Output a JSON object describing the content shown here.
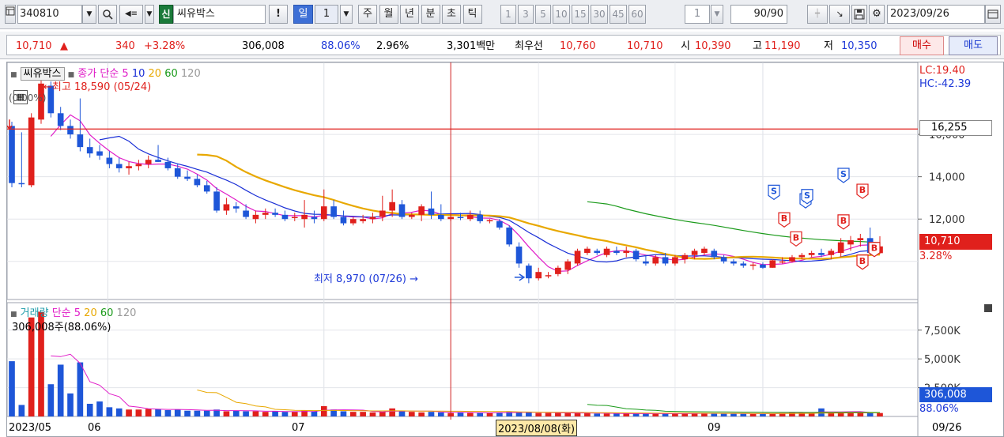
{
  "toolbar": {
    "stock_code": "340810",
    "badge": "신",
    "stock_name": "씨유박스",
    "period_day": "일",
    "period_num": "1",
    "periods": [
      "주",
      "월",
      "년",
      "분",
      "초",
      "틱"
    ],
    "minute_options": [
      "1",
      "3",
      "5",
      "10",
      "15",
      "30",
      "45",
      "60"
    ],
    "tick_value": "1",
    "count_current": "90",
    "count_total": "/90",
    "date": "2023/09/26"
  },
  "quote": {
    "price": "10,710",
    "up_mark": "▲",
    "change": "340",
    "change_pct": "+3.28%",
    "volume": "306,008",
    "volume_ratio": "88.06%",
    "turnover": "2.96%",
    "amount": "3,301백만",
    "best_label": "최우선",
    "best_ask": "10,760",
    "best_bid": "10,710",
    "open_label": "시",
    "open": "10,390",
    "high_label": "고",
    "high": "11,190",
    "low_label": "저",
    "low": "10,350",
    "buy_label": "매수",
    "sell_label": "매도"
  },
  "price_panel": {
    "name": "씨유박스",
    "ma_label": "종가 단순",
    "ma_periods": [
      "5",
      "10",
      "20",
      "60",
      "120"
    ],
    "high_marker": "←최고 18,590 (05/24)",
    "low_marker": "최저 8,970 (07/26) →",
    "left_pct": "(0.00%)",
    "lc": "LC:19.40",
    "hc": "HC:-42.39",
    "ref_price": "16,255",
    "axis_top_partial": "16,000",
    "current_price": "10,710",
    "current_pct": "3.28%"
  },
  "volume_panel": {
    "label": "거래량",
    "ma_label": "단순",
    "ma_periods": [
      "5",
      "20",
      "60",
      "120"
    ],
    "current_text": "306,008주(88.06%)",
    "current_volume": "306,008",
    "current_ratio": "88.06%",
    "axis_labels": [
      "7,500K",
      "5,000K",
      "2,500K"
    ]
  },
  "x_axis": {
    "start": "2023/05",
    "months": [
      "06",
      "07",
      "09"
    ],
    "cursor_date": "2023/08/08(화)",
    "end": "09/26"
  },
  "colors": {
    "up": "#e0201c",
    "down": "#1e56d8",
    "ma5": "#e01cc8",
    "ma10": "#1a2fd6",
    "ma20": "#e8a800",
    "ma60": "#1a9a1a",
    "ref_line": "#e0201c"
  },
  "signals": [
    "S",
    "B"
  ],
  "chart_data": {
    "type": "candlestick",
    "price_axis": {
      "ticks": [
        12000,
        14000,
        16000
      ],
      "min": 8200,
      "max": 19400
    },
    "volume_axis": {
      "ticks": [
        2500,
        5000,
        7500
      ],
      "unit": "K",
      "min": 0,
      "max": 9200
    },
    "candles": [
      {
        "o": 16400,
        "h": 16600,
        "l": 13500,
        "c": 13700
      },
      {
        "o": 13700,
        "h": 16100,
        "l": 13500,
        "c": 13650
      },
      {
        "o": 13600,
        "h": 17000,
        "l": 13500,
        "c": 16800
      },
      {
        "o": 16700,
        "h": 18590,
        "l": 16500,
        "c": 18400
      },
      {
        "o": 18300,
        "h": 18500,
        "l": 16800,
        "c": 17000
      },
      {
        "o": 17000,
        "h": 17300,
        "l": 16200,
        "c": 16400
      },
      {
        "o": 16400,
        "h": 16700,
        "l": 15800,
        "c": 16000
      },
      {
        "o": 16000,
        "h": 17700,
        "l": 15200,
        "c": 15400
      },
      {
        "o": 15400,
        "h": 15800,
        "l": 14900,
        "c": 15100
      },
      {
        "o": 15200,
        "h": 15500,
        "l": 14800,
        "c": 15000
      },
      {
        "o": 14900,
        "h": 15200,
        "l": 14400,
        "c": 14600
      },
      {
        "o": 14600,
        "h": 14900,
        "l": 14200,
        "c": 14400
      },
      {
        "o": 14400,
        "h": 14700,
        "l": 14100,
        "c": 14500
      },
      {
        "o": 14500,
        "h": 14800,
        "l": 14300,
        "c": 14600
      },
      {
        "o": 14600,
        "h": 15000,
        "l": 14400,
        "c": 14800
      },
      {
        "o": 14800,
        "h": 15500,
        "l": 14700,
        "c": 14700
      },
      {
        "o": 14700,
        "h": 14900,
        "l": 14300,
        "c": 14400
      },
      {
        "o": 14400,
        "h": 14600,
        "l": 13900,
        "c": 14000
      },
      {
        "o": 14000,
        "h": 14300,
        "l": 13800,
        "c": 13900
      },
      {
        "o": 13900,
        "h": 14100,
        "l": 13500,
        "c": 13600
      },
      {
        "o": 13600,
        "h": 13800,
        "l": 13200,
        "c": 13300
      },
      {
        "o": 13300,
        "h": 13500,
        "l": 12300,
        "c": 12400
      },
      {
        "o": 12400,
        "h": 13000,
        "l": 12200,
        "c": 12700
      },
      {
        "o": 12600,
        "h": 12800,
        "l": 12300,
        "c": 12500
      },
      {
        "o": 12400,
        "h": 12700,
        "l": 12000,
        "c": 12100
      },
      {
        "o": 12000,
        "h": 12400,
        "l": 11800,
        "c": 12200
      },
      {
        "o": 12200,
        "h": 12500,
        "l": 12000,
        "c": 12300
      },
      {
        "o": 12300,
        "h": 12500,
        "l": 12100,
        "c": 12200
      },
      {
        "o": 12200,
        "h": 12400,
        "l": 11900,
        "c": 12000
      },
      {
        "o": 12100,
        "h": 12300,
        "l": 11900,
        "c": 12100
      },
      {
        "o": 12000,
        "h": 12900,
        "l": 11600,
        "c": 12200
      },
      {
        "o": 12100,
        "h": 12400,
        "l": 11800,
        "c": 12000
      },
      {
        "o": 12000,
        "h": 13400,
        "l": 11900,
        "c": 12600
      },
      {
        "o": 12600,
        "h": 12900,
        "l": 12000,
        "c": 12100
      },
      {
        "o": 12100,
        "h": 12400,
        "l": 11700,
        "c": 11800
      },
      {
        "o": 11800,
        "h": 12100,
        "l": 11700,
        "c": 12000
      },
      {
        "o": 11900,
        "h": 12200,
        "l": 11800,
        "c": 12000
      },
      {
        "o": 12000,
        "h": 12300,
        "l": 11800,
        "c": 12100
      },
      {
        "o": 12100,
        "h": 13100,
        "l": 11900,
        "c": 12400
      },
      {
        "o": 12400,
        "h": 13400,
        "l": 12100,
        "c": 12800
      },
      {
        "o": 12700,
        "h": 12900,
        "l": 12000,
        "c": 12100
      },
      {
        "o": 12100,
        "h": 12300,
        "l": 12000,
        "c": 12200
      },
      {
        "o": 12200,
        "h": 12700,
        "l": 11900,
        "c": 12600
      },
      {
        "o": 12500,
        "h": 13300,
        "l": 12000,
        "c": 12200
      },
      {
        "o": 12200,
        "h": 12700,
        "l": 11900,
        "c": 12000
      },
      {
        "o": 12000,
        "h": 12300,
        "l": 11900,
        "c": 12100
      },
      {
        "o": 12100,
        "h": 12300,
        "l": 11950,
        "c": 12050
      },
      {
        "o": 12000,
        "h": 12400,
        "l": 11900,
        "c": 12200
      },
      {
        "o": 12200,
        "h": 12400,
        "l": 11800,
        "c": 11900
      },
      {
        "o": 11900,
        "h": 12000,
        "l": 11800,
        "c": 11950
      },
      {
        "o": 11900,
        "h": 12000,
        "l": 11500,
        "c": 11600
      },
      {
        "o": 11600,
        "h": 11700,
        "l": 10700,
        "c": 10800
      },
      {
        "o": 10700,
        "h": 10900,
        "l": 9700,
        "c": 9900
      },
      {
        "o": 9800,
        "h": 9900,
        "l": 8970,
        "c": 9200
      },
      {
        "o": 9200,
        "h": 9700,
        "l": 9100,
        "c": 9500
      },
      {
        "o": 9300,
        "h": 9500,
        "l": 9200,
        "c": 9350
      },
      {
        "o": 9400,
        "h": 9800,
        "l": 9300,
        "c": 9700
      },
      {
        "o": 9600,
        "h": 10100,
        "l": 9400,
        "c": 10000
      },
      {
        "o": 9900,
        "h": 10600,
        "l": 9800,
        "c": 10500
      },
      {
        "o": 10400,
        "h": 10700,
        "l": 10300,
        "c": 10600
      },
      {
        "o": 10500,
        "h": 10600,
        "l": 10300,
        "c": 10400
      },
      {
        "o": 10300,
        "h": 10700,
        "l": 10200,
        "c": 10600
      },
      {
        "o": 10500,
        "h": 10700,
        "l": 10300,
        "c": 10400
      },
      {
        "o": 10400,
        "h": 10700,
        "l": 10200,
        "c": 10500
      },
      {
        "o": 10500,
        "h": 10600,
        "l": 10000,
        "c": 10100
      },
      {
        "o": 10000,
        "h": 10300,
        "l": 9800,
        "c": 9900
      },
      {
        "o": 9900,
        "h": 10300,
        "l": 9800,
        "c": 10200
      },
      {
        "o": 10200,
        "h": 10400,
        "l": 9800,
        "c": 9900
      },
      {
        "o": 9900,
        "h": 10300,
        "l": 9800,
        "c": 10200
      },
      {
        "o": 10100,
        "h": 10400,
        "l": 9900,
        "c": 10300
      },
      {
        "o": 10300,
        "h": 10600,
        "l": 10100,
        "c": 10500
      },
      {
        "o": 10400,
        "h": 10700,
        "l": 10300,
        "c": 10600
      },
      {
        "o": 10500,
        "h": 10600,
        "l": 10100,
        "c": 10200
      },
      {
        "o": 10200,
        "h": 10300,
        "l": 9900,
        "c": 10000
      },
      {
        "o": 10000,
        "h": 10100,
        "l": 9800,
        "c": 9900
      },
      {
        "o": 9900,
        "h": 10000,
        "l": 9700,
        "c": 9800
      },
      {
        "o": 9800,
        "h": 9950,
        "l": 9600,
        "c": 9850
      },
      {
        "o": 9850,
        "h": 9950,
        "l": 9650,
        "c": 9700
      },
      {
        "o": 9700,
        "h": 10100,
        "l": 9700,
        "c": 10050
      },
      {
        "o": 10000,
        "h": 10200,
        "l": 9900,
        "c": 10000
      },
      {
        "o": 10000,
        "h": 10300,
        "l": 9950,
        "c": 10200
      },
      {
        "o": 10200,
        "h": 10400,
        "l": 10100,
        "c": 10300
      },
      {
        "o": 10300,
        "h": 10500,
        "l": 10200,
        "c": 10400
      },
      {
        "o": 10400,
        "h": 10600,
        "l": 10200,
        "c": 10300
      },
      {
        "o": 10300,
        "h": 10600,
        "l": 10100,
        "c": 10500
      },
      {
        "o": 10400,
        "h": 11100,
        "l": 10200,
        "c": 10900
      },
      {
        "o": 10800,
        "h": 11200,
        "l": 10500,
        "c": 11000
      },
      {
        "o": 11000,
        "h": 11300,
        "l": 10700,
        "c": 11100
      },
      {
        "o": 11100,
        "h": 11600,
        "l": 10300,
        "c": 10400
      },
      {
        "o": 10390,
        "h": 11190,
        "l": 10350,
        "c": 10710
      }
    ],
    "volumes_K": [
      4800,
      1000,
      8600,
      9100,
      2800,
      4500,
      2000,
      4700,
      1100,
      1300,
      800,
      700,
      600,
      600,
      650,
      650,
      550,
      600,
      500,
      500,
      500,
      600,
      450,
      500,
      450,
      450,
      400,
      450,
      400,
      400,
      500,
      450,
      900,
      600,
      450,
      400,
      400,
      350,
      400,
      700,
      450,
      400,
      350,
      400,
      350,
      300,
      350,
      300,
      300,
      300,
      350,
      400,
      400,
      350,
      300,
      300,
      300,
      300,
      300,
      300,
      250,
      250,
      250,
      250,
      250,
      250,
      250,
      250,
      250,
      250,
      300,
      300,
      250,
      250,
      250,
      250,
      250,
      250,
      250,
      300,
      350,
      350,
      300,
      700,
      300,
      350,
      400,
      350,
      300,
      300
    ]
  }
}
